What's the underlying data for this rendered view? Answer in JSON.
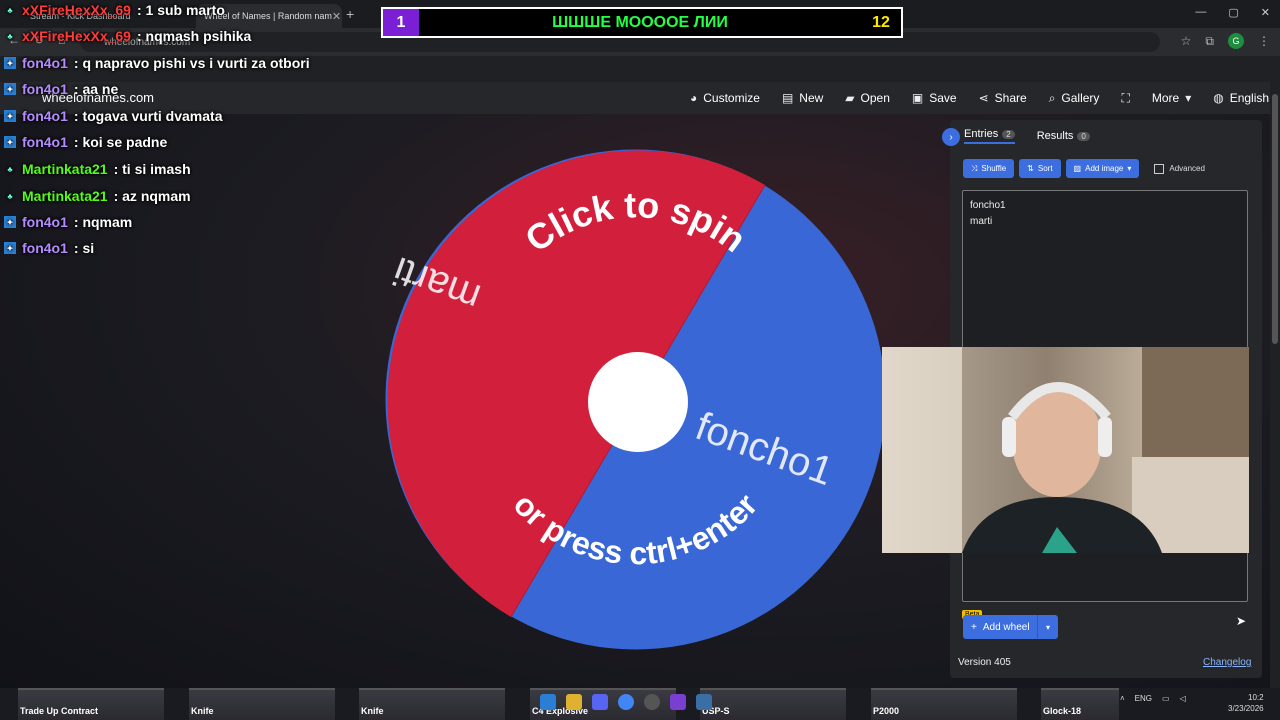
{
  "browser": {
    "tabs": [
      {
        "label": "Stream - Kick Dashboard"
      },
      {
        "label": "Wheel of Names | Random nam"
      }
    ],
    "new_tab": "+",
    "url": "wheelofnames.com",
    "profile_initial": "G",
    "window_controls": [
      "—",
      "▢",
      "✕"
    ]
  },
  "site": {
    "brand": "wheelofnames.com",
    "menu": [
      {
        "icon": "palette-icon",
        "glyph": "◕",
        "label": "Customize"
      },
      {
        "icon": "file-icon",
        "glyph": "▤",
        "label": "New"
      },
      {
        "icon": "folder-icon",
        "glyph": "▰",
        "label": "Open"
      },
      {
        "icon": "save-icon",
        "glyph": "▣",
        "label": "Save"
      },
      {
        "icon": "share-icon",
        "glyph": "⋖",
        "label": "Share"
      },
      {
        "icon": "search-icon",
        "glyph": "⌕",
        "label": "Gallery"
      },
      {
        "icon": "fullscreen-icon",
        "glyph": "⛶",
        "label": ""
      },
      {
        "icon": "chevron-down-icon",
        "glyph": "▾",
        "label": "More"
      },
      {
        "icon": "globe-icon",
        "glyph": "◍",
        "label": "English"
      }
    ]
  },
  "wheel": {
    "segments": [
      {
        "label": "marti",
        "color": "#d21f3c"
      },
      {
        "label": "foncho1",
        "color": "#3a67d6"
      }
    ],
    "top_text": "Click to spin",
    "bottom_text": "or press ctrl+enter"
  },
  "panel": {
    "tabs": [
      {
        "label": "Entries",
        "count": "2"
      },
      {
        "label": "Results",
        "count": "0"
      }
    ],
    "buttons": {
      "shuffle": "Shuffle",
      "sort": "Sort",
      "add_image": "Add image",
      "advanced": "Advanced"
    },
    "entries": [
      "foncho1",
      "marti"
    ],
    "beta": "Beta",
    "add_wheel": "Add wheel",
    "version": "Version 405",
    "changelog": "Changelog"
  },
  "chat": [
    {
      "user": "xXFireHexXx_69",
      "msg": ": 1 sub marto",
      "color": "#ff3b3b",
      "badge": "g"
    },
    {
      "user": "xXFireHexXx_69",
      "msg": ": nqmash psihika",
      "color": "#ff3b3b",
      "badge": "g"
    },
    {
      "user": "fon4o1",
      "msg": ": q napravo pishi vs i vurti za otbori",
      "color": "#b58cff",
      "badge": "b"
    },
    {
      "user": "fon4o1",
      "msg": ": aa ne",
      "color": "#b58cff",
      "badge": "b"
    },
    {
      "user": "fon4o1",
      "msg": ": togava vurti dvamata",
      "color": "#b58cff",
      "badge": "b"
    },
    {
      "user": "fon4o1",
      "msg": ": koi se padne",
      "color": "#b58cff",
      "badge": "b"
    },
    {
      "user": "Martinkata21",
      "msg": ": ti si imash",
      "color": "#53fc18",
      "badge": "g"
    },
    {
      "user": "Martinkata21",
      "msg": ": az nqmam",
      "color": "#53fc18",
      "badge": "g"
    },
    {
      "user": "fon4o1",
      "msg": ": nqmam",
      "color": "#b58cff",
      "badge": "b"
    },
    {
      "user": "fon4o1",
      "msg": ": si",
      "color": "#b58cff",
      "badge": "b"
    }
  ],
  "scoreboard": {
    "left": "1",
    "title": "ШШШЕ МОООOE ЛИИ",
    "right": "12"
  },
  "inventory": [
    {
      "label": "Trade Up Contract"
    },
    {
      "label": "Knife"
    },
    {
      "label": "Knife"
    },
    {
      "label": "C4 Explosive"
    },
    {
      "label": "USP-S"
    },
    {
      "label": "P2000"
    },
    {
      "label": "Glock-18"
    }
  ],
  "tray": {
    "lang": "ENG",
    "time": "10:2",
    "date": "3/23/2026"
  }
}
